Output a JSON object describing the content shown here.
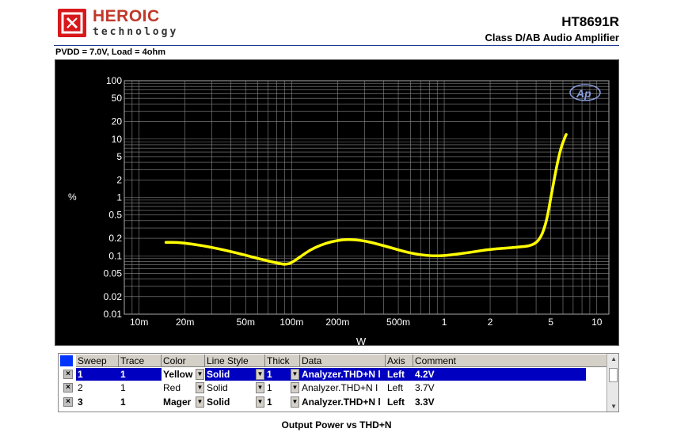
{
  "header": {
    "brand_name": "HEROIC",
    "brand_sub": "technology",
    "part_number": "HT8691R",
    "part_desc": "Class D/AB Audio Amplifier",
    "condition": "PVDD = 7.0V, Load = 4ohm"
  },
  "caption": "Output Power vs THD+N",
  "chart_data": {
    "type": "line",
    "xlabel": "W",
    "ylabel": "%",
    "x_scale": "log",
    "y_scale": "log",
    "xlim": [
      0.008,
      12
    ],
    "ylim": [
      0.01,
      100
    ],
    "x_ticks": [
      {
        "v": 0.01,
        "label": "10m"
      },
      {
        "v": 0.02,
        "label": "20m"
      },
      {
        "v": 0.05,
        "label": "50m"
      },
      {
        "v": 0.1,
        "label": "100m"
      },
      {
        "v": 0.2,
        "label": "200m"
      },
      {
        "v": 0.5,
        "label": "500m"
      },
      {
        "v": 1,
        "label": "1"
      },
      {
        "v": 2,
        "label": "2"
      },
      {
        "v": 5,
        "label": "5"
      },
      {
        "v": 10,
        "label": "10"
      }
    ],
    "y_ticks": [
      {
        "v": 100,
        "label": "100"
      },
      {
        "v": 50,
        "label": "50"
      },
      {
        "v": 20,
        "label": "20"
      },
      {
        "v": 10,
        "label": "10"
      },
      {
        "v": 5,
        "label": "5"
      },
      {
        "v": 2,
        "label": "2"
      },
      {
        "v": 1,
        "label": "1"
      },
      {
        "v": 0.5,
        "label": "0.5"
      },
      {
        "v": 0.2,
        "label": "0.2"
      },
      {
        "v": 0.1,
        "label": "0.1"
      },
      {
        "v": 0.05,
        "label": "0.05"
      },
      {
        "v": 0.02,
        "label": "0.02"
      },
      {
        "v": 0.01,
        "label": "0.01"
      }
    ],
    "grid": true,
    "watermark": "Ap",
    "series": [
      {
        "color": "#e8188c",
        "values": [
          [
            0.015,
            0.17
          ],
          [
            0.018,
            0.17
          ],
          [
            0.022,
            0.16
          ],
          [
            0.03,
            0.14
          ],
          [
            0.045,
            0.11
          ],
          [
            0.06,
            0.09
          ],
          [
            0.08,
            0.075
          ],
          [
            0.095,
            0.07
          ],
          [
            0.11,
            0.09
          ],
          [
            0.14,
            0.14
          ],
          [
            0.2,
            0.19
          ],
          [
            0.28,
            0.19
          ],
          [
            0.4,
            0.15
          ],
          [
            0.6,
            0.11
          ],
          [
            0.8,
            0.1
          ],
          [
            1.0,
            0.1
          ],
          [
            1.5,
            0.115
          ],
          [
            2.0,
            0.13
          ],
          [
            3.0,
            0.14
          ],
          [
            3.8,
            0.15
          ],
          [
            4.3,
            0.2
          ],
          [
            4.7,
            0.4
          ],
          [
            5.0,
            1.0
          ],
          [
            5.4,
            3.0
          ],
          [
            5.8,
            7.0
          ],
          [
            6.3,
            12.0
          ]
        ]
      },
      {
        "color": "#ff2020",
        "values": [
          [
            0.015,
            0.17
          ],
          [
            0.018,
            0.17
          ],
          [
            0.022,
            0.16
          ],
          [
            0.03,
            0.14
          ],
          [
            0.045,
            0.11
          ],
          [
            0.06,
            0.09
          ],
          [
            0.08,
            0.075
          ],
          [
            0.095,
            0.07
          ],
          [
            0.11,
            0.09
          ],
          [
            0.14,
            0.14
          ],
          [
            0.2,
            0.19
          ],
          [
            0.28,
            0.19
          ],
          [
            0.4,
            0.15
          ],
          [
            0.6,
            0.11
          ],
          [
            0.8,
            0.1
          ],
          [
            1.0,
            0.1
          ],
          [
            1.5,
            0.115
          ],
          [
            2.0,
            0.13
          ],
          [
            3.0,
            0.14
          ],
          [
            3.8,
            0.15
          ],
          [
            4.3,
            0.2
          ],
          [
            4.7,
            0.4
          ],
          [
            5.0,
            1.0
          ],
          [
            5.4,
            3.0
          ],
          [
            5.8,
            7.0
          ],
          [
            6.3,
            12.0
          ]
        ]
      },
      {
        "color": "#ffff00",
        "values": [
          [
            0.015,
            0.17
          ],
          [
            0.018,
            0.17
          ],
          [
            0.022,
            0.16
          ],
          [
            0.03,
            0.14
          ],
          [
            0.045,
            0.11
          ],
          [
            0.06,
            0.09
          ],
          [
            0.08,
            0.075
          ],
          [
            0.095,
            0.07
          ],
          [
            0.11,
            0.09
          ],
          [
            0.14,
            0.14
          ],
          [
            0.2,
            0.19
          ],
          [
            0.28,
            0.19
          ],
          [
            0.4,
            0.15
          ],
          [
            0.6,
            0.11
          ],
          [
            0.8,
            0.1
          ],
          [
            1.0,
            0.1
          ],
          [
            1.5,
            0.115
          ],
          [
            2.0,
            0.13
          ],
          [
            3.0,
            0.14
          ],
          [
            3.8,
            0.15
          ],
          [
            4.3,
            0.2
          ],
          [
            4.7,
            0.4
          ],
          [
            5.0,
            1.0
          ],
          [
            5.4,
            3.0
          ],
          [
            5.8,
            7.0
          ],
          [
            6.3,
            12.0
          ]
        ]
      }
    ]
  },
  "legend_table": {
    "headers": [
      "Sweep",
      "Trace",
      "Color",
      "Line Style",
      "Thick",
      "Data",
      "Axis",
      "Comment"
    ],
    "rows": [
      {
        "sweep": "1",
        "trace": "1",
        "color": "Yellow",
        "line_style": "Solid",
        "thick": "1",
        "data": "Analyzer.THD+N l",
        "axis": "Left",
        "comment": "4.2V"
      },
      {
        "sweep": "2",
        "trace": "1",
        "color": "Red",
        "line_style": "Solid",
        "thick": "1",
        "data": "Analyzer.THD+N I",
        "axis": "Left",
        "comment": "3.7V"
      },
      {
        "sweep": "3",
        "trace": "1",
        "color": "Mager",
        "line_style": "Solid",
        "thick": "1",
        "data": "Analyzer.THD+N l",
        "axis": "Left",
        "comment": "3.3V"
      }
    ],
    "check_mark": "×"
  }
}
